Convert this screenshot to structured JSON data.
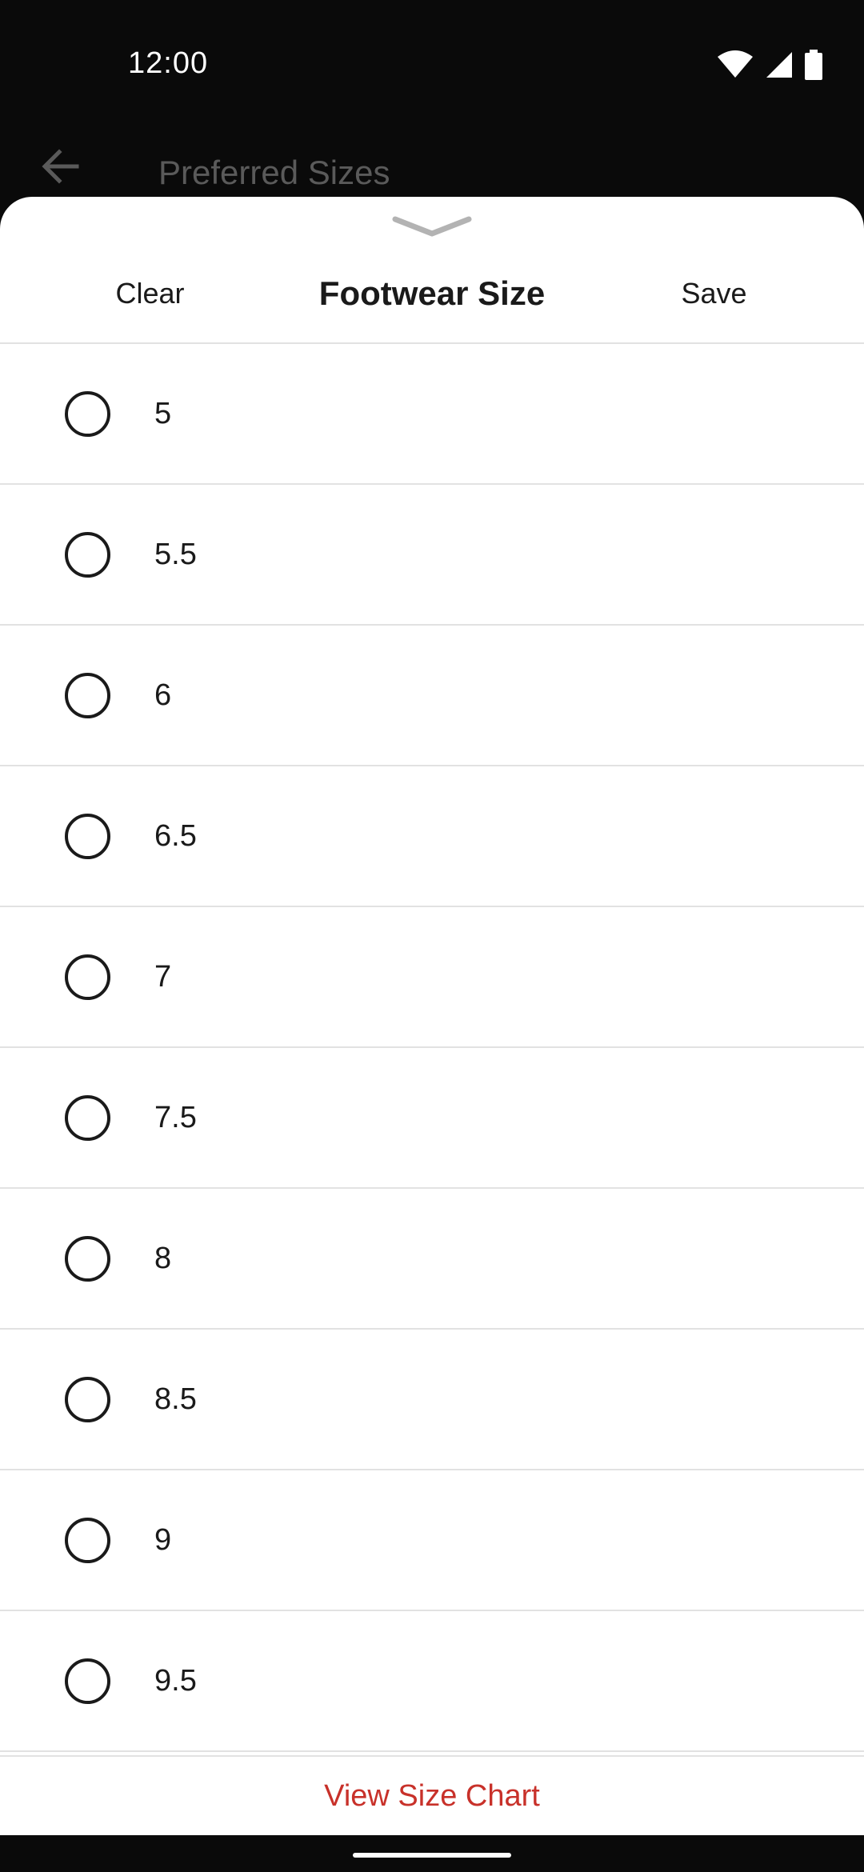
{
  "status_bar": {
    "time": "12:00",
    "icons": [
      "wifi-icon",
      "cellular-signal-icon",
      "battery-icon"
    ]
  },
  "app_bar": {
    "back_icon": "arrow-left-icon",
    "title": "Preferred Sizes"
  },
  "sheet": {
    "handle_icon": "chevron-down-icon",
    "clear_label": "Clear",
    "title": "Footwear Size",
    "save_label": "Save",
    "sizes": [
      {
        "label": "5",
        "selected": false
      },
      {
        "label": "5.5",
        "selected": false
      },
      {
        "label": "6",
        "selected": false
      },
      {
        "label": "6.5",
        "selected": false
      },
      {
        "label": "7",
        "selected": false
      },
      {
        "label": "7.5",
        "selected": false
      },
      {
        "label": "8",
        "selected": false
      },
      {
        "label": "8.5",
        "selected": false
      },
      {
        "label": "9",
        "selected": false
      },
      {
        "label": "9.5",
        "selected": false
      }
    ],
    "size_chart_label": "View Size Chart"
  },
  "colors": {
    "accent": "#c8312a",
    "text": "#1a1a1a",
    "divider": "#e2e2e2",
    "background_dark": "#0a0a0a"
  }
}
